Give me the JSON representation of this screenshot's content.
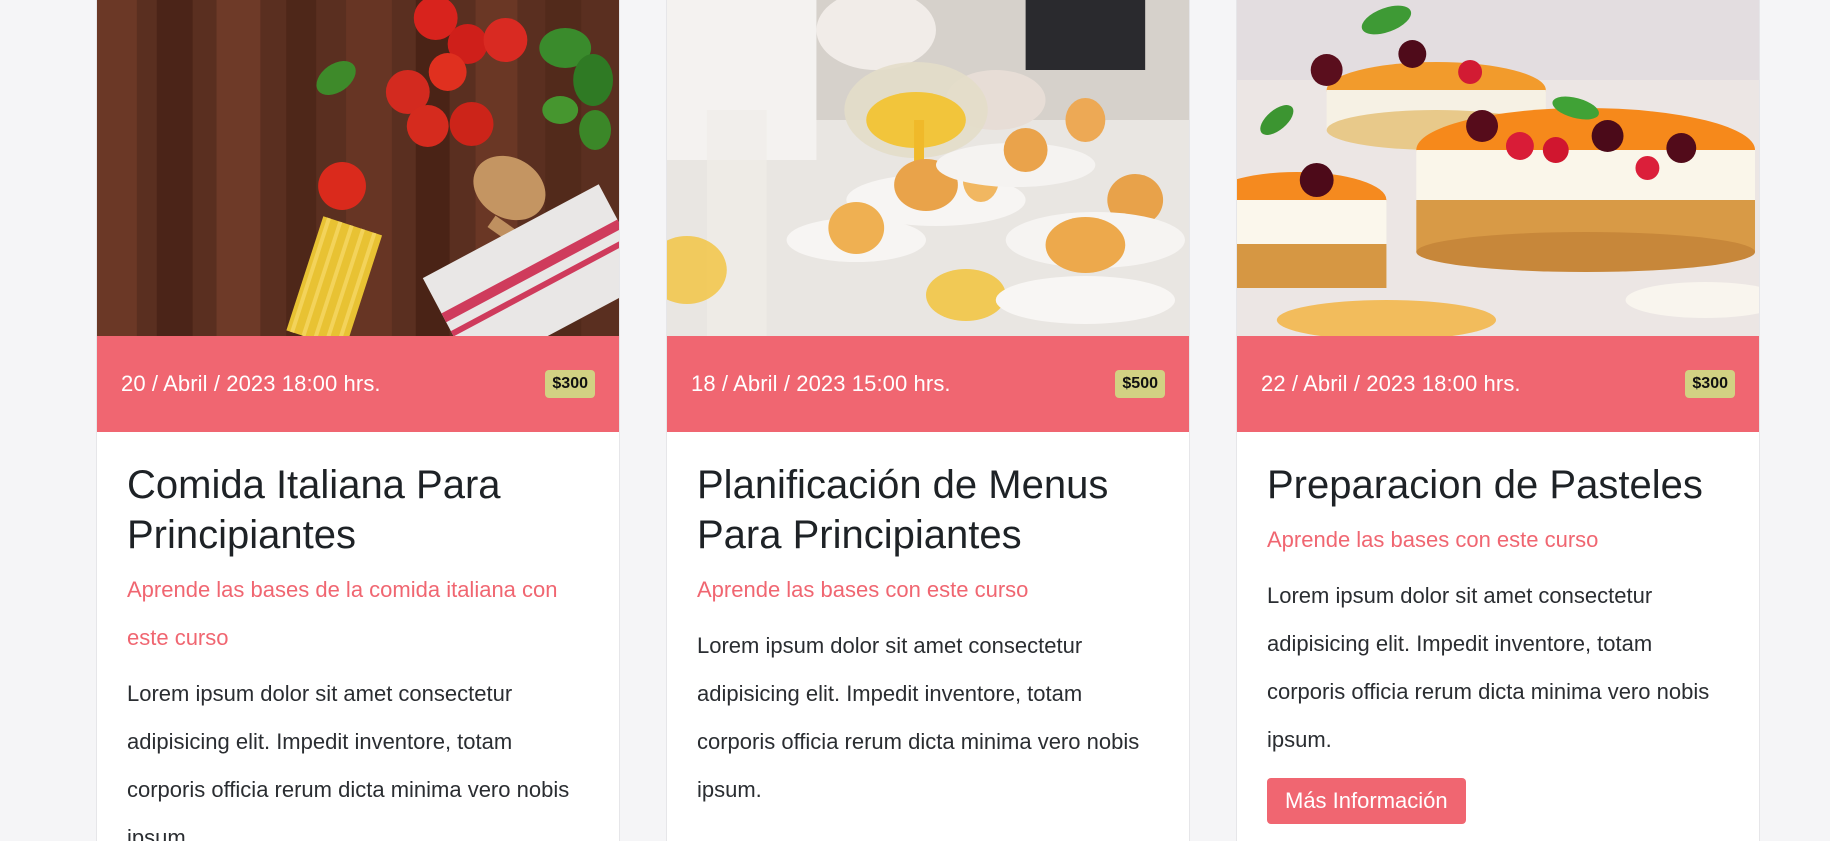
{
  "cards": [
    {
      "date": "20 / Abril / 2023 18:00 hrs.",
      "price": "$300",
      "title": "Comida Italiana Para Principiantes",
      "subtitle": "Aprende las bases de la comida italiana con este curso",
      "text": "Lorem ipsum dolor sit amet consectetur adipisicing elit. Impedit inventore, totam corporis officia rerum dicta minima vero nobis ipsum.",
      "image_icon": "italian-ingredients-photo"
    },
    {
      "date": "18 / Abril / 2023 15:00 hrs.",
      "price": "$500",
      "title": "Planificación de Menus Para Principiantes",
      "subtitle": "Aprende las bases con este curso",
      "text": "Lorem ipsum dolor sit amet consectetur adipisicing elit. Impedit inventore, totam corporis officia rerum dicta minima vero nobis ipsum.",
      "image_icon": "chef-plating-photo"
    },
    {
      "date": "22 / Abril / 2023 18:00 hrs.",
      "price": "$300",
      "title": "Preparacion de Pasteles",
      "subtitle": "Aprende las bases con este curso",
      "text": "Lorem ipsum dolor sit amet consectetur adipisicing elit. Impedit inventore, totam corporis officia rerum dicta minima vero nobis ipsum.",
      "button": "Más Información",
      "image_icon": "cheesecake-photo"
    }
  ],
  "colors": {
    "accent": "#f06671",
    "badge": "#d2d183",
    "background": "#f5f5f7",
    "title": "#1e2226"
  }
}
